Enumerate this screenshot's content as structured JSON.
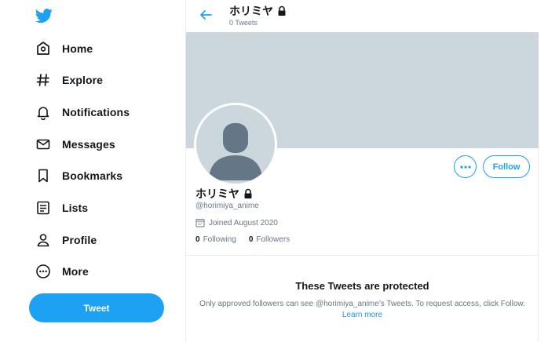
{
  "nav": {
    "items": [
      {
        "label": "Home",
        "icon": "home-icon"
      },
      {
        "label": "Explore",
        "icon": "hashtag-icon"
      },
      {
        "label": "Notifications",
        "icon": "bell-icon"
      },
      {
        "label": "Messages",
        "icon": "envelope-icon"
      },
      {
        "label": "Bookmarks",
        "icon": "bookmark-icon"
      },
      {
        "label": "Lists",
        "icon": "list-icon"
      },
      {
        "label": "Profile",
        "icon": "person-icon"
      },
      {
        "label": "More",
        "icon": "more-circle-icon"
      }
    ],
    "tweet_label": "Tweet"
  },
  "header": {
    "name": "ホリミヤ",
    "tweet_count": "0 Tweets"
  },
  "profile": {
    "name": "ホリミヤ",
    "handle": "@horimiya_anime",
    "joined": "Joined August 2020",
    "following_count": "0",
    "following_label": "Following",
    "followers_count": "0",
    "followers_label": "Followers",
    "follow_label": "Follow"
  },
  "protected": {
    "title": "These Tweets are protected",
    "text": "Only approved followers can see @horimiya_anime’s Tweets. To request access, click Follow.",
    "link": "Learn more"
  },
  "colors": {
    "accent": "#1da1f2",
    "banner": "#ccd6dd",
    "muted": "#657786"
  }
}
